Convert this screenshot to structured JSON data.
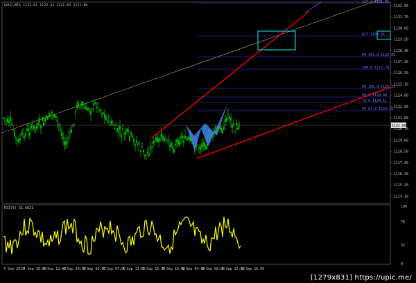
{
  "chart": {
    "symbol_header": "GOLD,M15  1122.01 1122.42 1121.81 1121.86",
    "rsi_header": "RSI(5) 51.6021",
    "current_price_tag": "1121.86"
  },
  "price_axis_labels": [
    "1132.90",
    "1131.70",
    "1130.60",
    "1129.50",
    "1128.40",
    "1127.30",
    "1126.20",
    "1125.10",
    "1124.00",
    "1122.90",
    "1121.80",
    "1120.70",
    "1119.60",
    "1118.50",
    "1117.40",
    "1116.30",
    "1115.20",
    "1114.10"
  ],
  "rsi_axis_labels": [
    "100",
    "70",
    "32",
    "0"
  ],
  "time_axis_labels": [
    "4 Sep 2015",
    "4 Sep 10:00",
    "4 Sep 12:00",
    "4 Sep 14:00",
    "7 Sep 03:00",
    "7 Sep 07:00",
    "7 Sep 11:00",
    "7 Sep 15:00",
    "7 Sep 19:00",
    "8 Sep 04:00",
    "8 Sep 08:00",
    "8 Sep 12:00",
    "8 Sep 16:00"
  ],
  "fib_labels": [
    "127.2 1131.95",
    "DIY 1130.61",
    "FE 161.8 1129.89",
    "100.0 1127.74",
    "FE 100.0 1125.21",
    "88.6 1124.49",
    "78.6 1124.11",
    "FE 61.8 1123.28"
  ],
  "watermark": "[1279x831] https://upic.me/",
  "colors": {
    "background": "#000000",
    "bull_candle": "#00ff00",
    "bear_candle": "#00ff00",
    "rsi_line": "#ffff00",
    "trend_lines": "#ff0000",
    "fib_lines": "#3a3aff",
    "pattern_fill": "#3f7fe6",
    "highlight_box": "#00e6e6",
    "long_trend": "#c8a060"
  }
}
